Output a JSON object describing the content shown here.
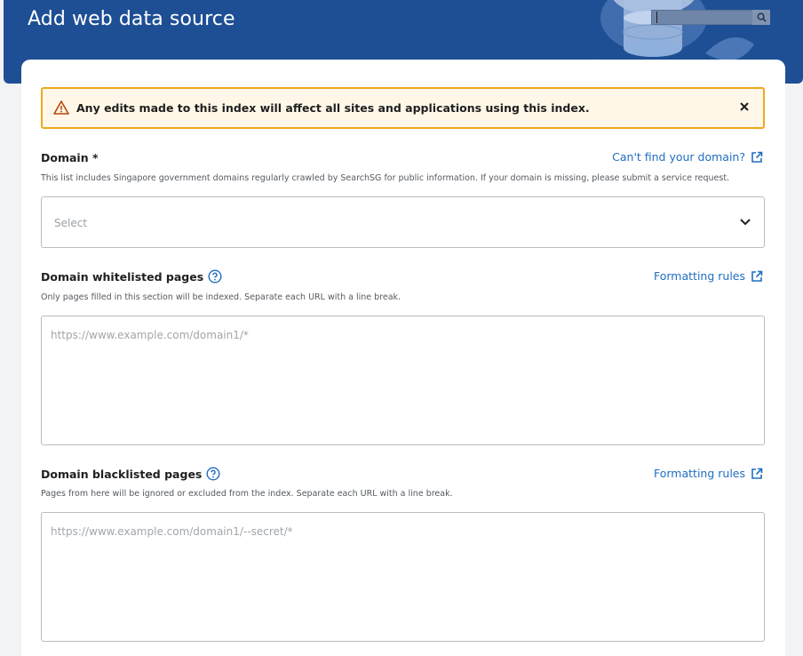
{
  "header": {
    "title": "Add web data source",
    "search_icon": "search-icon",
    "illustration": "database-illustration"
  },
  "alert": {
    "icon": "warning-icon",
    "message": "Any edits made to this index will affect all sites and applications using this index.",
    "close_icon": "close-icon",
    "border_color": "#f0a81e",
    "background_color": "#fff8e8"
  },
  "domain": {
    "label": "Domain *",
    "help_link": "Can't find your domain?",
    "description": "This list includes Singapore government domains regularly crawled by SearchSG for public information. If your domain is missing, please submit a service request.",
    "select_placeholder": "Select",
    "chevron_icon": "chevron-down-icon"
  },
  "whitelist": {
    "label": "Domain whitelisted pages",
    "link": "Formatting rules",
    "description": "Only pages filled in this section will be indexed. Separate each URL with a line break.",
    "placeholder": "https://www.example.com/domain1/*"
  },
  "blacklist": {
    "label": "Domain blacklisted pages",
    "link": "Formatting rules",
    "description": "Pages from here will be ignored or excluded from the index. Separate each URL with a line break.",
    "placeholder": "https://www.example.com/domain1/--secret/*"
  },
  "colors": {
    "header_blue": "#1e4f95",
    "link_blue": "#1f6ec1",
    "warning_orange": "#f0a81e"
  }
}
